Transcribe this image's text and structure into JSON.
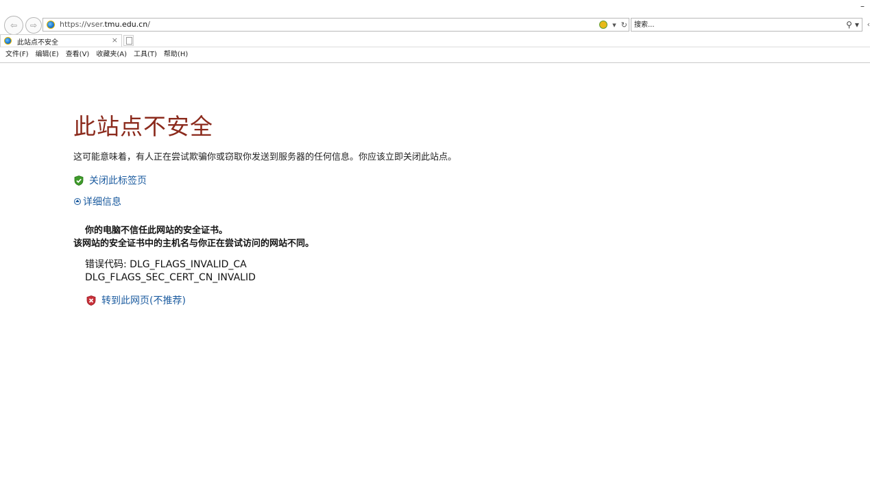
{
  "window": {
    "minimize_glyph": "–"
  },
  "toolbar": {
    "back_glyph": "⇦",
    "forward_glyph": "⇨",
    "url_prefix": "https://vser.",
    "url_host": "tmu.edu.cn",
    "url_suffix": "/",
    "dropdown_glyph": "▾",
    "refresh_glyph": "↻",
    "search_placeholder": "搜索...",
    "search_glyph": "⚲",
    "edge_glyph": "‹"
  },
  "tab": {
    "label": "此站点不安全",
    "close_glyph": "×"
  },
  "menu": {
    "items": [
      "文件(F)",
      "编辑(E)",
      "查看(V)",
      "收藏夹(A)",
      "工具(T)",
      "帮助(H)"
    ]
  },
  "page": {
    "title": "此站点不安全",
    "description": "这可能意味着，有人正在尝试欺骗你或窃取你发送到服务器的任何信息。你应该立即关闭此站点。",
    "close_tab_label": "关闭此标签页",
    "details_label": "详细信息",
    "detail_line_1": "你的电脑不信任此网站的安全证书。",
    "detail_line_2": "该网站的安全证书中的主机名与你正在尝试访问的网站不同。",
    "error_code_line_1": "错误代码: DLG_FLAGS_INVALID_CA",
    "error_code_line_2": "DLG_FLAGS_SEC_CERT_CN_INVALID",
    "goto_label": "转到此网页(不推荐)"
  },
  "colors": {
    "title_red": "#8b2a1c",
    "link_blue": "#1b5b9f",
    "shield_green": "#3f9a2b",
    "shield_red": "#c8313a"
  }
}
